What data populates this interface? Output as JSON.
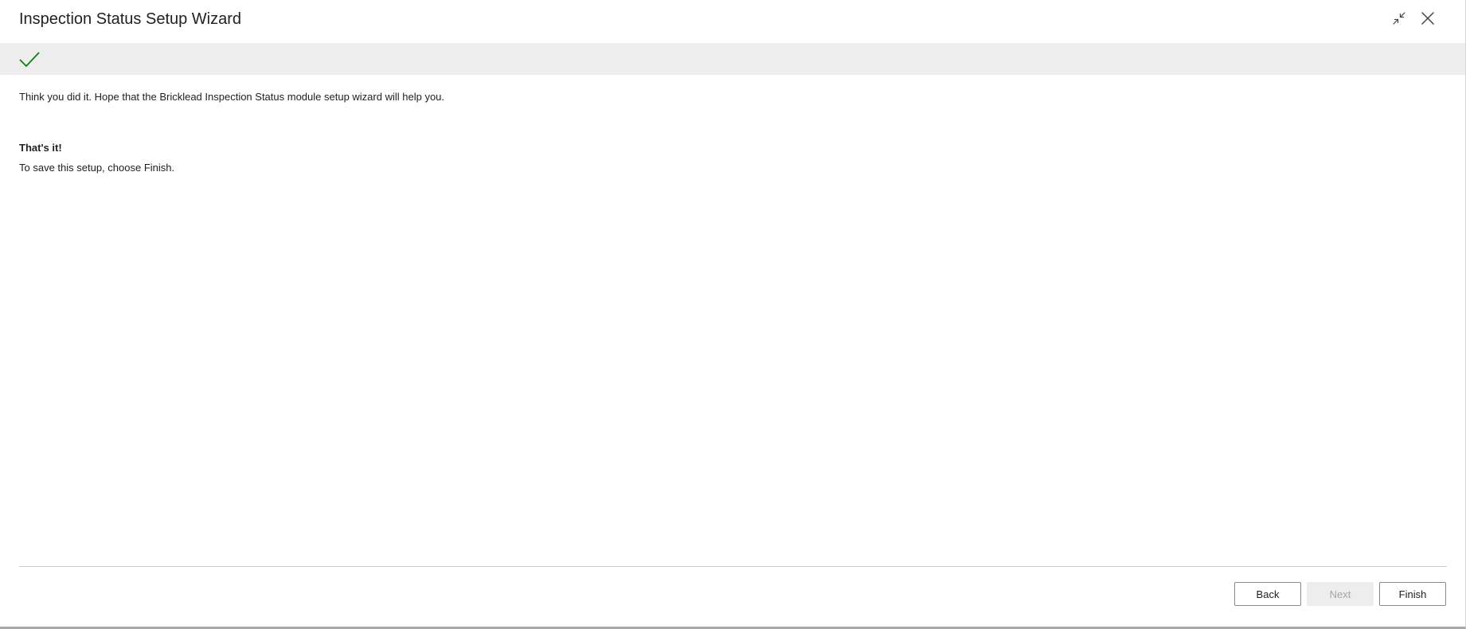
{
  "window": {
    "title": "Inspection Status Setup Wizard",
    "collapse_icon": "collapse-arrows-icon",
    "close_icon": "close-icon"
  },
  "status": {
    "icon": "checkmark-icon",
    "icon_color": "#107c10"
  },
  "content": {
    "intro": "Think you did it. Hope that the Bricklead Inspection Status module setup wizard will help you.",
    "done_heading": "That's it!",
    "done_text": "To save this setup, choose Finish."
  },
  "footer": {
    "back_label": "Back",
    "next_label": "Next",
    "next_disabled": true,
    "finish_label": "Finish"
  }
}
